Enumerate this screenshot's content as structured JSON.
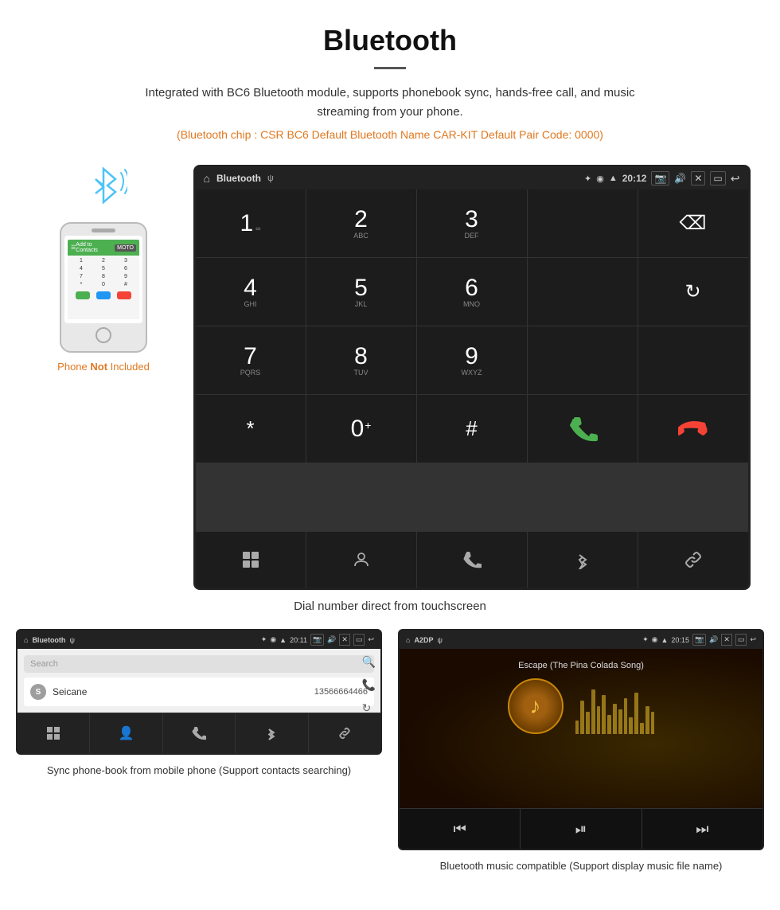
{
  "header": {
    "title": "Bluetooth",
    "description": "Integrated with BC6 Bluetooth module, supports phonebook sync, hands-free call, and music streaming from your phone.",
    "specs": "(Bluetooth chip : CSR BC6    Default Bluetooth Name CAR-KIT    Default Pair Code: 0000)"
  },
  "car_screen": {
    "status_bar": {
      "title": "Bluetooth",
      "usb": "ψ",
      "time": "20:12",
      "icons": [
        "📷",
        "🔊",
        "✕",
        "▭",
        "↩"
      ]
    },
    "dialpad": {
      "keys": [
        {
          "num": "1",
          "sub": ""
        },
        {
          "num": "2",
          "sub": "ABC"
        },
        {
          "num": "3",
          "sub": "DEF"
        },
        {
          "num": "",
          "sub": ""
        },
        {
          "num": "",
          "sub": "backspace"
        },
        {
          "num": "4",
          "sub": "GHI"
        },
        {
          "num": "5",
          "sub": "JKL"
        },
        {
          "num": "6",
          "sub": "MNO"
        },
        {
          "num": "",
          "sub": ""
        },
        {
          "num": "",
          "sub": ""
        },
        {
          "num": "7",
          "sub": "PQRS"
        },
        {
          "num": "8",
          "sub": "TUV"
        },
        {
          "num": "9",
          "sub": "WXYZ"
        },
        {
          "num": "",
          "sub": ""
        },
        {
          "num": "",
          "sub": "refresh"
        },
        {
          "num": "*",
          "sub": ""
        },
        {
          "num": "0",
          "sub": "+"
        },
        {
          "num": "#",
          "sub": ""
        },
        {
          "num": "",
          "sub": "call-green"
        },
        {
          "num": "",
          "sub": "call-red"
        }
      ],
      "toolbar": [
        "grid",
        "person",
        "phone",
        "bluetooth",
        "link"
      ]
    }
  },
  "caption": "Dial number direct from touchscreen",
  "phone_label": {
    "line1": "Phone Not Included",
    "line1_bold_part": "Not"
  },
  "phonebook_screen": {
    "status_bar": {
      "title": "Bluetooth",
      "time": "20:11"
    },
    "search_placeholder": "Search",
    "contacts": [
      {
        "initial": "S",
        "name": "Seicane",
        "number": "13566664466"
      }
    ],
    "toolbar": [
      "grid",
      "person",
      "phone",
      "bluetooth",
      "link"
    ]
  },
  "music_screen": {
    "status_bar": {
      "title": "A2DP",
      "time": "20:15"
    },
    "song_title": "Escape (The Pina Colada Song)",
    "controls": [
      "prev",
      "play-pause",
      "next"
    ]
  },
  "bottom_captions": {
    "phonebook": "Sync phone-book from mobile phone\n(Support contacts searching)",
    "music": "Bluetooth music compatible\n(Support display music file name)"
  },
  "colors": {
    "orange": "#e07820",
    "green": "#4CAF50",
    "red": "#f44336",
    "blue_light": "#4fc3f7"
  }
}
